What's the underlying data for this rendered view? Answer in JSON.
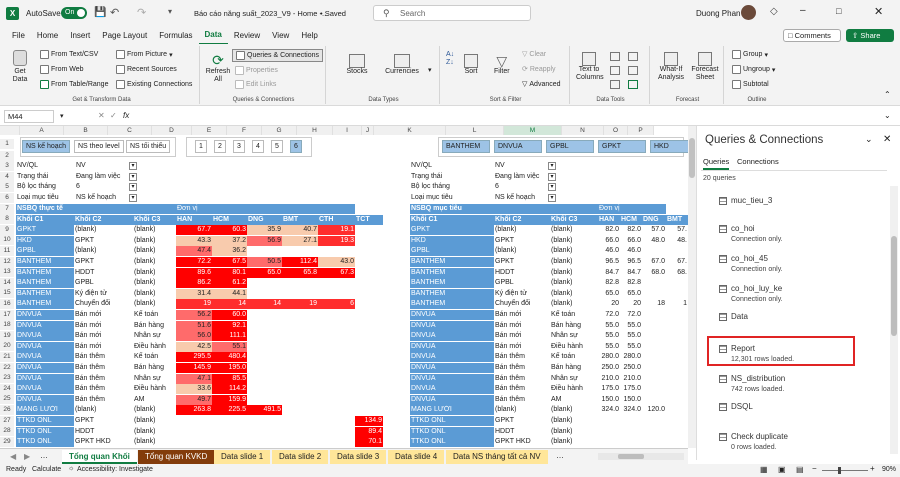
{
  "titlebar": {
    "autosave": "AutoSave",
    "toggle": "On",
    "filename": "Báo cáo năng suất_2023_V9 - Home -...",
    "saved": "• Saved",
    "search": "Search",
    "user": "Duong Phan"
  },
  "menu": [
    "File",
    "Home",
    "Insert",
    "Page Layout",
    "Formulas",
    "Data",
    "Review",
    "View",
    "Help"
  ],
  "comments": "Comments",
  "share": "Share",
  "ribbon": {
    "getdata": "Get Data",
    "from_text": "From Text/CSV",
    "from_web": "From Web",
    "from_table": "From Table/Range",
    "from_picture": "From Picture",
    "recent": "Recent Sources",
    "existing": "Existing Connections",
    "g1": "Get & Transform Data",
    "refresh": "Refresh All",
    "qc": "Queries & Connections",
    "props": "Properties",
    "editlinks": "Edit Links",
    "g2": "Queries & Connections",
    "stocks": "Stocks",
    "currencies": "Currencies",
    "g3": "Data Types",
    "sort": "Sort",
    "filter": "Filter",
    "clear": "Clear",
    "reapply": "Reapply",
    "advanced": "Advanced",
    "g4": "Sort & Filter",
    "t2c": "Text to Columns",
    "g5": "Data Tools",
    "whatif": "What-If Analysis",
    "forecast": "Forecast Sheet",
    "g6": "Forecast",
    "group": "Group",
    "ungroup": "Ungroup",
    "subtotal": "Subtotal",
    "g7": "Outline"
  },
  "namebox": "M44",
  "fx": "fx",
  "cols": [
    "A",
    "B",
    "C",
    "D",
    "E",
    "F",
    "G",
    "H",
    "I",
    "J",
    "K",
    "L",
    "M",
    "N",
    "O",
    "P"
  ],
  "slicer1": [
    "NS kế hoạch",
    "NS theo level",
    "NS tối thiểu"
  ],
  "slicer2": [
    "1",
    "2",
    "3",
    "4",
    "5",
    "6"
  ],
  "slicer3": [
    "BANTHEM",
    "DNVUA",
    "GPBL",
    "GPKT",
    "HKD"
  ],
  "filters_left": [
    [
      "NV/QL",
      "NV"
    ],
    [
      "Trạng thái",
      "Đang làm việc"
    ],
    [
      "Bộ lọc tháng",
      "6"
    ],
    [
      "Loại mục tiêu",
      "NS kế hoạch"
    ]
  ],
  "filters_right": [
    [
      "NV/QL",
      "NV"
    ],
    [
      "Trạng thái",
      "Đang làm việc"
    ],
    [
      "Bộ lọc tháng",
      "6"
    ],
    [
      "Loại mục tiêu",
      "NS kế hoạch"
    ]
  ],
  "left_table": {
    "title": "NSBQ thực tế",
    "unit": "Đơn vị",
    "hdr": [
      "Khối C1",
      "Khối C2",
      "Khối C3",
      "HAN",
      "HCM",
      "DNG",
      "BMT",
      "CTH",
      "TCT"
    ],
    "rows": [
      [
        "GPKT",
        "(blank)",
        "(blank)",
        "67.7",
        "60.3",
        "35.9",
        "40.7",
        "19.1",
        ""
      ],
      [
        "HKD",
        "GPKT",
        "(blank)",
        "43.3",
        "37.2",
        "56.9",
        "27.1",
        "19.3",
        ""
      ],
      [
        "GPBL",
        "(blank)",
        "(blank)",
        "47.4",
        "36.2",
        "",
        "",
        "",
        ""
      ],
      [
        "BANTHEM",
        "GPKT",
        "(blank)",
        "72.2",
        "67.5",
        "50.5",
        "112.4",
        "43.0",
        ""
      ],
      [
        "BANTHEM",
        "HDDT",
        "(blank)",
        "89.6",
        "80.1",
        "65.0",
        "65.8",
        "67.3",
        ""
      ],
      [
        "BANTHEM",
        "GPBL",
        "(blank)",
        "86.2",
        "61.2",
        "",
        "",
        "",
        ""
      ],
      [
        "BANTHEM",
        "Ký điện tử",
        "(blank)",
        "31.4",
        "44.1",
        "",
        "",
        "",
        ""
      ],
      [
        "BANTHEM",
        "Chuyển đổi",
        "(blank)",
        "19",
        "14",
        "14",
        "19",
        "6",
        ""
      ],
      [
        "DNVUA",
        "Bán mới",
        "Kế toán",
        "56.2",
        "60.0",
        "",
        "",
        "",
        ""
      ],
      [
        "DNVUA",
        "Bán mới",
        "Bán hàng",
        "51.6",
        "92.1",
        "",
        "",
        "",
        ""
      ],
      [
        "DNVUA",
        "Bán mới",
        "Nhân sự",
        "56.0",
        "111.1",
        "",
        "",
        "",
        ""
      ],
      [
        "DNVUA",
        "Bán mới",
        "Điều hành",
        "42.5",
        "55.1",
        "",
        "",
        "",
        ""
      ],
      [
        "DNVUA",
        "Bán thêm",
        "Kế toán",
        "295.5",
        "480.4",
        "",
        "",
        "",
        ""
      ],
      [
        "DNVUA",
        "Bán thêm",
        "Bán hàng",
        "145.9",
        "195.0",
        "",
        "",
        "",
        ""
      ],
      [
        "DNVUA",
        "Bán thêm",
        "Nhân sự",
        "47.1",
        "85.5",
        "",
        "",
        "",
        ""
      ],
      [
        "DNVUA",
        "Bán thêm",
        "Điều hành",
        "33.6",
        "114.2",
        "",
        "",
        "",
        ""
      ],
      [
        "DNVUA",
        "Bán thêm",
        "AM",
        "49.7",
        "159.9",
        "",
        "",
        "",
        ""
      ],
      [
        "MANG LƯỚI",
        "(blank)",
        "(blank)",
        "263.8",
        "225.5",
        "491.5",
        "",
        "",
        ""
      ],
      [
        "TTKD ONL",
        "GPKT",
        "(blank)",
        "",
        "",
        "",
        "",
        "",
        "134.9"
      ],
      [
        "TTKD ONL",
        "HDDT",
        "(blank)",
        "",
        "",
        "",
        "",
        "",
        "89.4"
      ],
      [
        "TTKD ONL",
        "GPKT HKD",
        "(blank)",
        "",
        "",
        "",
        "",
        "",
        "70.1"
      ]
    ]
  },
  "right_table": {
    "title": "NSBQ mục tiêu",
    "unit": "Đơn vị",
    "hdr": [
      "Khối C1",
      "Khối C2",
      "Khối C3",
      "HAN",
      "HCM",
      "DNG",
      "BMT"
    ],
    "rows": [
      [
        "GPKT",
        "(blank)",
        "(blank)",
        "82.0",
        "82.0",
        "57.0",
        "57."
      ],
      [
        "HKD",
        "GPKT",
        "(blank)",
        "66.0",
        "66.0",
        "48.0",
        "48."
      ],
      [
        "GPBL",
        "(blank)",
        "(blank)",
        "46.0",
        "46.0",
        "",
        ""
      ],
      [
        "BANTHEM",
        "GPKT",
        "(blank)",
        "96.5",
        "96.5",
        "67.0",
        "67."
      ],
      [
        "BANTHEM",
        "HDDT",
        "(blank)",
        "84.7",
        "84.7",
        "68.0",
        "68."
      ],
      [
        "BANTHEM",
        "GPBL",
        "(blank)",
        "82.8",
        "82.8",
        "",
        ""
      ],
      [
        "BANTHEM",
        "Ký điện tử",
        "(blank)",
        "65.0",
        "65.0",
        "",
        ""
      ],
      [
        "BANTHEM",
        "Chuyển đổi",
        "(blank)",
        "20",
        "20",
        "18",
        "1"
      ],
      [
        "DNVUA",
        "Bán mới",
        "Kế toán",
        "72.0",
        "72.0",
        "",
        ""
      ],
      [
        "DNVUA",
        "Bán mới",
        "Bán hàng",
        "55.0",
        "55.0",
        "",
        ""
      ],
      [
        "DNVUA",
        "Bán mới",
        "Nhân sự",
        "55.0",
        "55.0",
        "",
        ""
      ],
      [
        "DNVUA",
        "Bán mới",
        "Điều hành",
        "55.0",
        "55.0",
        "",
        ""
      ],
      [
        "DNVUA",
        "Bán thêm",
        "Kế toán",
        "280.0",
        "280.0",
        "",
        ""
      ],
      [
        "DNVUA",
        "Bán thêm",
        "Bán hàng",
        "250.0",
        "250.0",
        "",
        ""
      ],
      [
        "DNVUA",
        "Bán thêm",
        "Nhân sự",
        "210.0",
        "210.0",
        "",
        ""
      ],
      [
        "DNVUA",
        "Bán thêm",
        "Điều hành",
        "175.0",
        "175.0",
        "",
        ""
      ],
      [
        "DNVUA",
        "Bán thêm",
        "AM",
        "150.0",
        "150.0",
        "",
        ""
      ],
      [
        "MANG LƯỚI",
        "(blank)",
        "(blank)",
        "324.0",
        "324.0",
        "120.0",
        ""
      ],
      [
        "TTKD ONL",
        "GPKT",
        "(blank)",
        "",
        "",
        "",
        ""
      ],
      [
        "TTKD ONL",
        "HDDT",
        "(blank)",
        "",
        "",
        "",
        ""
      ],
      [
        "TTKD ONL",
        "GPKT HKD",
        "(blank)",
        "",
        "",
        "",
        ""
      ]
    ]
  },
  "pane": {
    "title": "Queries & Connections",
    "tab1": "Queries",
    "tab2": "Connections",
    "count": "20 queries",
    "items": [
      {
        "name": "muc_tieu_3",
        "sub": ""
      },
      {
        "name": "co_hoi",
        "sub": "Connection only."
      },
      {
        "name": "co_hoi_45",
        "sub": "Connection only."
      },
      {
        "name": "co_hoi_luy_ke",
        "sub": "Connection only."
      },
      {
        "name": "Data",
        "sub": ""
      },
      {
        "name": "Report",
        "sub": "12,301 rows loaded."
      },
      {
        "name": "NS_distribution",
        "sub": "742 rows loaded."
      },
      {
        "name": "DSQL",
        "sub": ""
      },
      {
        "name": "Check duplicate",
        "sub": "0 rows loaded."
      }
    ]
  },
  "tabs": [
    "Tổng quan Khối",
    "Tổng quan KVKD",
    "Data slide 1",
    "Data slide 2",
    "Data slide 3",
    "Data slide 4",
    "Data NS tháng tất cả NV"
  ],
  "status": {
    "ready": "Ready",
    "calculate": "Calculate",
    "access": "Accessibility: Investigate",
    "zoom": "90%"
  }
}
